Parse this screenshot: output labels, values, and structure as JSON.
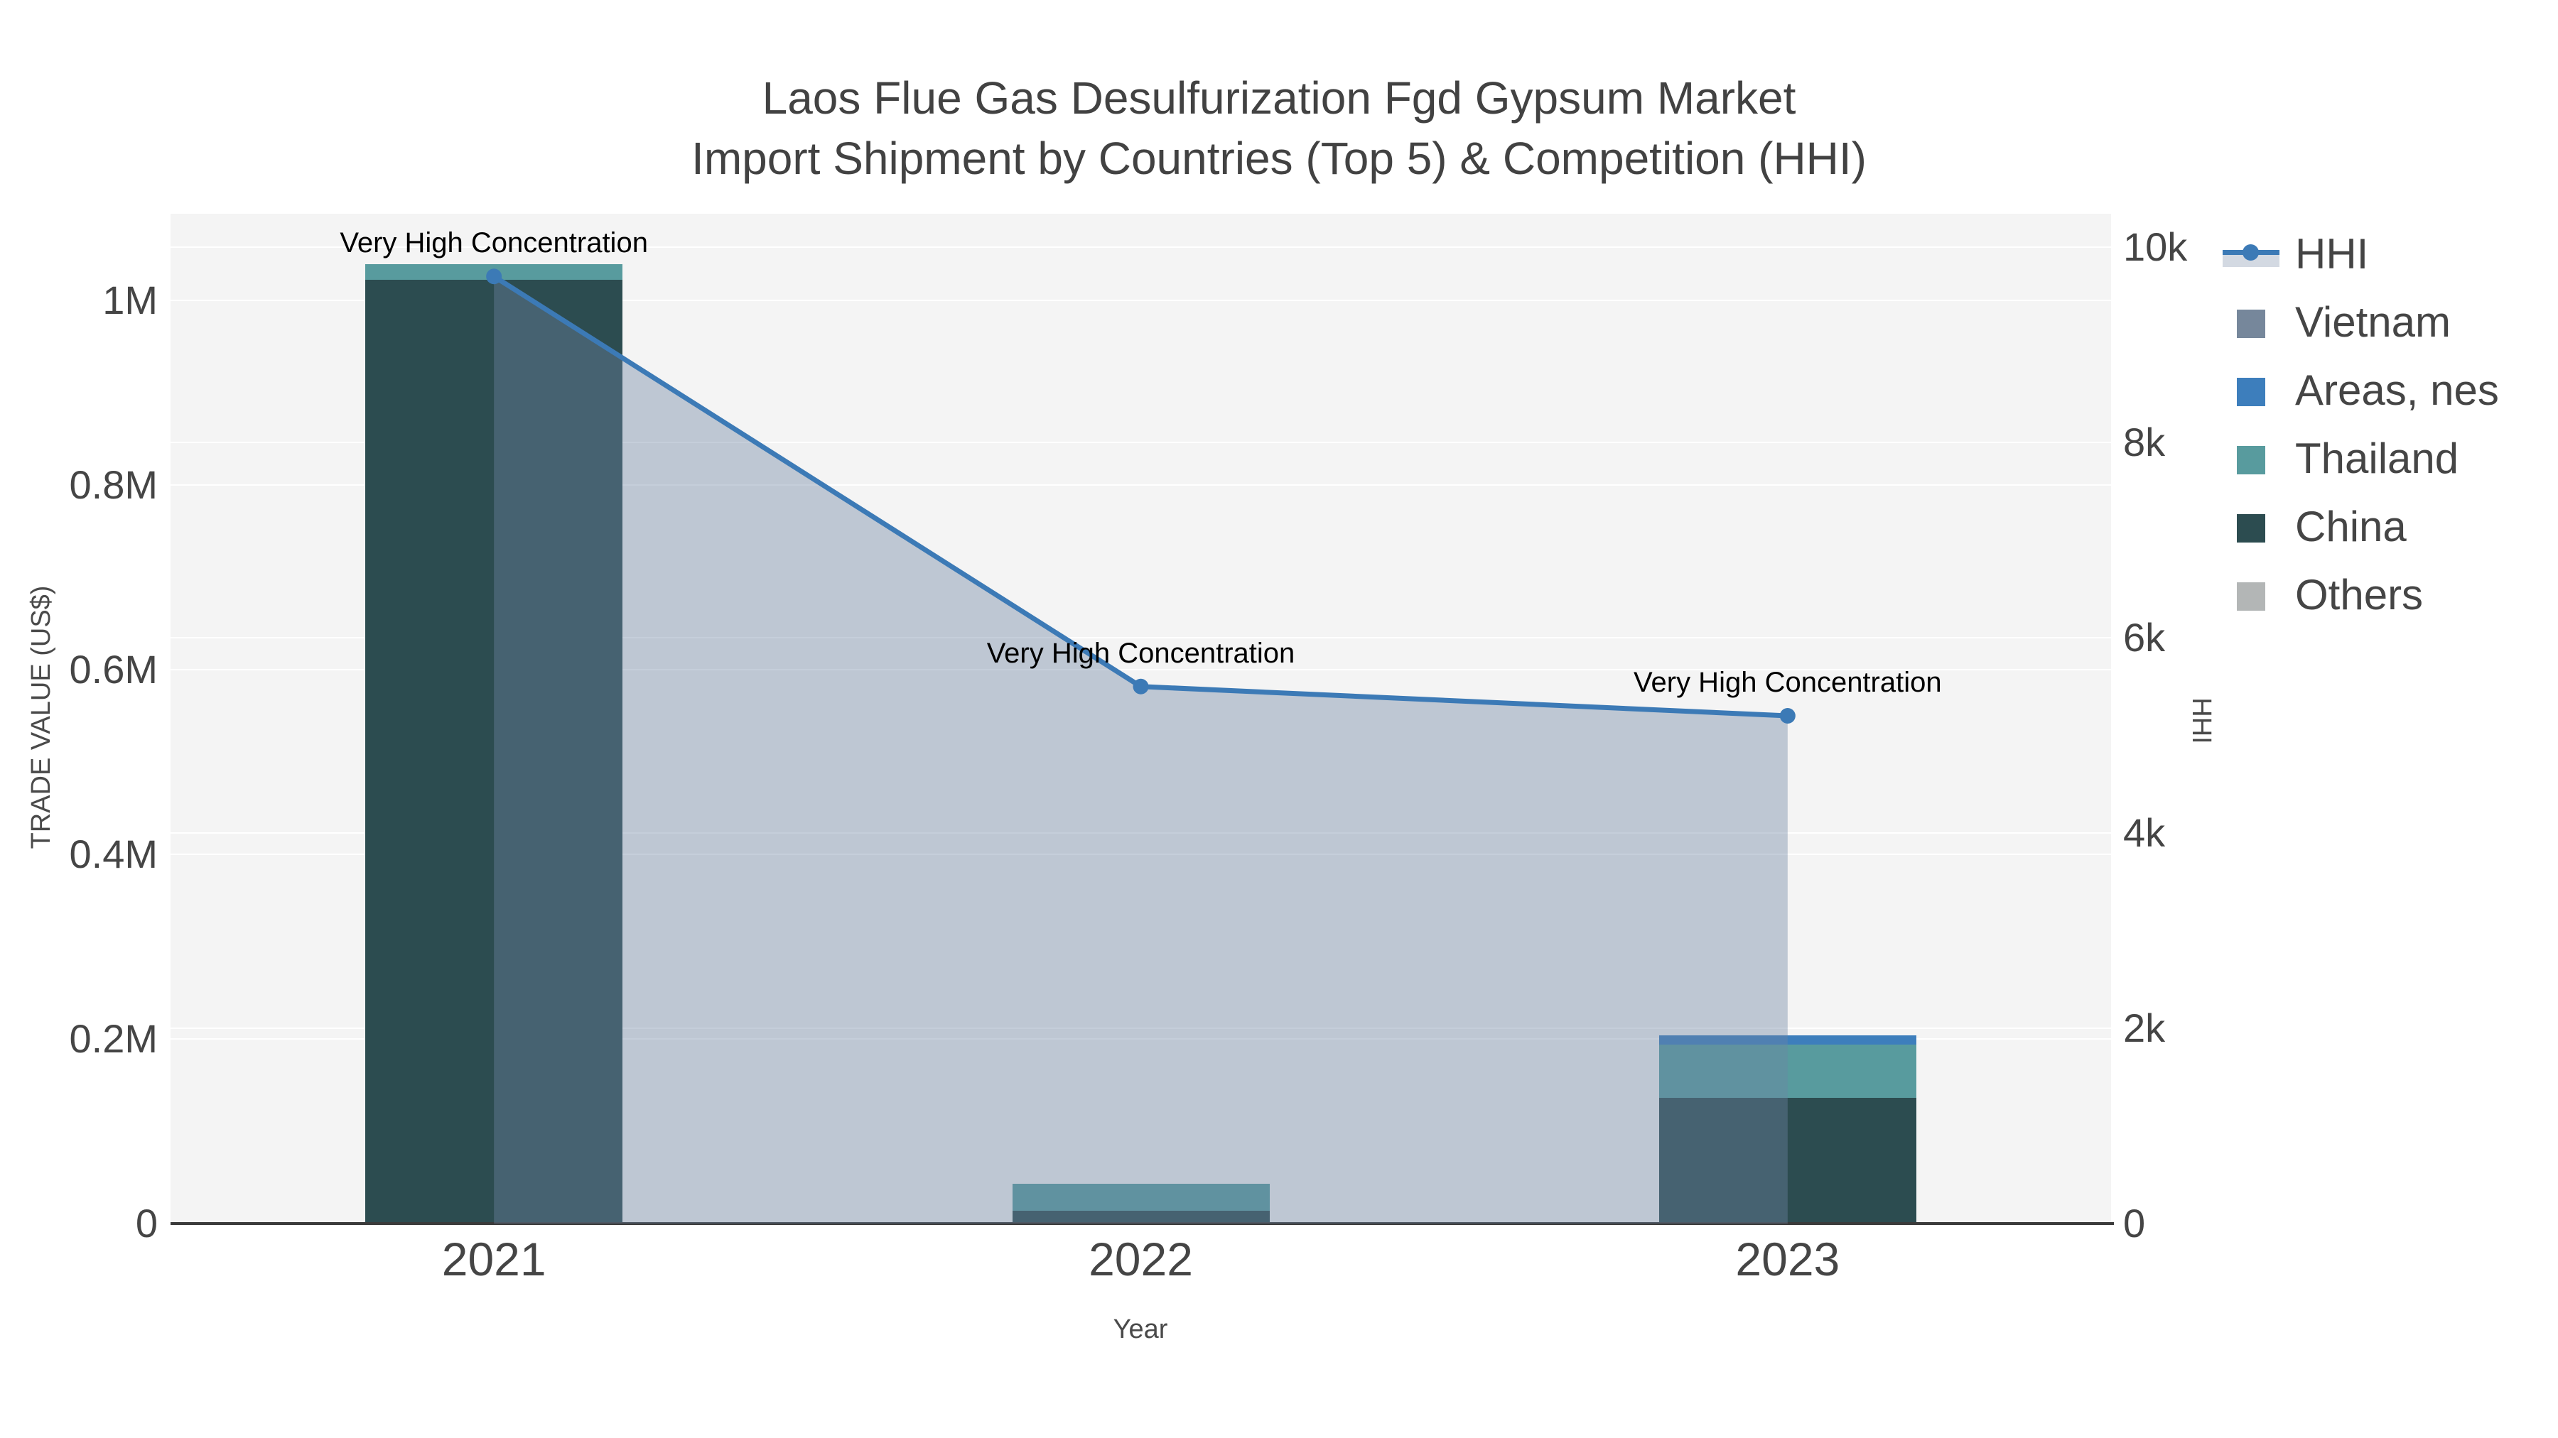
{
  "title": {
    "line1": "Laos Flue Gas Desulfurization Fgd Gypsum Market",
    "line2": "Import Shipment by Countries (Top 5) & Competition (HHI)"
  },
  "axes": {
    "x": {
      "title": "Year",
      "categories": [
        "2021",
        "2022",
        "2023"
      ]
    },
    "left": {
      "title": "TRADE VALUE (US$)",
      "ticks": [
        {
          "v": 0,
          "label": "0"
        },
        {
          "v": 200000,
          "label": "0.2M"
        },
        {
          "v": 400000,
          "label": "0.4M"
        },
        {
          "v": 600000,
          "label": "0.6M"
        },
        {
          "v": 800000,
          "label": "0.8M"
        },
        {
          "v": 1000000,
          "label": "1M"
        }
      ]
    },
    "right": {
      "title": "HHI",
      "ticks": [
        {
          "v": 0,
          "label": "0"
        },
        {
          "v": 2000,
          "label": "2k"
        },
        {
          "v": 4000,
          "label": "4k"
        },
        {
          "v": 6000,
          "label": "6k"
        },
        {
          "v": 8000,
          "label": "8k"
        },
        {
          "v": 10000,
          "label": "10k"
        }
      ]
    }
  },
  "legend": [
    {
      "label": "HHI",
      "symbol": "line",
      "color": "#3c7ab6",
      "band": "#d3d9e2"
    },
    {
      "label": "Vietnam",
      "symbol": "square",
      "color": "#76879b"
    },
    {
      "label": "Areas, nes",
      "symbol": "square",
      "color": "#3d7ebc"
    },
    {
      "label": "Thailand",
      "symbol": "square",
      "color": "#589b9e"
    },
    {
      "label": "China",
      "symbol": "square",
      "color": "#2c4c50"
    },
    {
      "label": "Others",
      "symbol": "square",
      "color": "#b3b6b6"
    }
  ],
  "annotations": [
    {
      "year": "2021",
      "text": "Very High Concentration"
    },
    {
      "year": "2022",
      "text": "Very High Concentration"
    },
    {
      "year": "2023",
      "text": "Very High Concentration"
    }
  ],
  "chart_data": {
    "type": "combo: stacked bar (left axis) + line with area fill (right axis)",
    "categories": [
      "2021",
      "2022",
      "2023"
    ],
    "bar_series": [
      {
        "name": "China",
        "color": "#2c4c50",
        "values": [
          1022000,
          14000,
          136000
        ]
      },
      {
        "name": "Thailand",
        "color": "#589b9e",
        "values": [
          17000,
          29000,
          58000
        ]
      },
      {
        "name": "Areas, nes",
        "color": "#3d7ebc",
        "values": [
          0,
          0,
          10000
        ]
      },
      {
        "name": "Vietnam",
        "color": "#76879b",
        "values": [
          0,
          0,
          0
        ]
      },
      {
        "name": "Others",
        "color": "#b3b6b6",
        "values": [
          0,
          0,
          0
        ]
      }
    ],
    "line_series": {
      "name": "HHI",
      "axis": "right",
      "color": "#3c7ab6",
      "fill": "rgba(110,132,162,0.40)",
      "values": [
        9700,
        5500,
        5200
      ]
    },
    "title": "Laos Flue Gas Desulfurization Fgd Gypsum Market Import Shipment by Countries (Top 5) & Competition (HHI)",
    "xlabel": "Year",
    "ylabel_left": "TRADE VALUE (US$)",
    "ylabel_right": "HHI",
    "ylim_left": [
      0,
      1094000
    ],
    "ylim_right": [
      0,
      10340
    ],
    "grid": true,
    "plot_background": "#f4f4f4",
    "legend_position": "right"
  }
}
